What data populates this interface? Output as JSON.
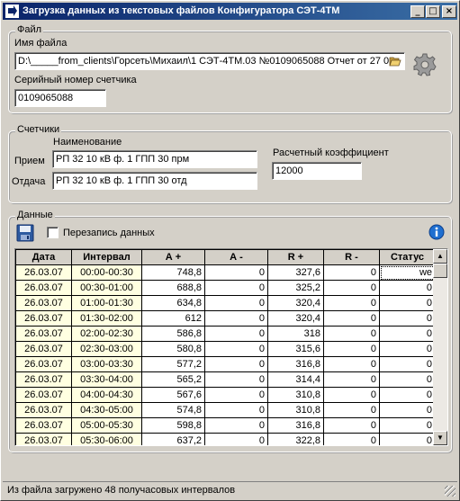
{
  "window": {
    "title": "Загрузка данных из текстовых файлов Конфигуратора СЭТ-4ТМ",
    "minimize": "_",
    "maximize": "□",
    "close": "×"
  },
  "file_group": {
    "legend": "Файл",
    "filename_label": "Имя файла",
    "filename_value": "D:\\_____from_clients\\Горсеть\\Михаил\\1 СЭТ-4ТМ.03 №0109065088 Отчет от 27 0",
    "serial_label": "Серийный номер счетчика",
    "serial_value": "0109065088"
  },
  "meters_group": {
    "legend": "Счетчики",
    "name_header": "Наименование",
    "receive_label": "Прием",
    "receive_value": "РП 32 10 кВ ф. 1 ГПП 30 прм",
    "send_label": "Отдача",
    "send_value": "РП 32 10 кВ ф. 1 ГПП 30 отд",
    "coef_label": "Расчетный коэффициент",
    "coef_value": "12000"
  },
  "data_group": {
    "legend": "Данные",
    "overwrite_label": "Перезапись данных",
    "columns": [
      "Дата",
      "Интервал",
      "А +",
      "А -",
      "R +",
      "R -",
      "Статус"
    ],
    "rows": [
      [
        "26.03.07",
        "00:00-00:30",
        "748,8",
        "0",
        "327,6",
        "0",
        "we"
      ],
      [
        "26.03.07",
        "00:30-01:00",
        "688,8",
        "0",
        "325,2",
        "0",
        "0"
      ],
      [
        "26.03.07",
        "01:00-01:30",
        "634,8",
        "0",
        "320,4",
        "0",
        "0"
      ],
      [
        "26.03.07",
        "01:30-02:00",
        "612",
        "0",
        "320,4",
        "0",
        "0"
      ],
      [
        "26.03.07",
        "02:00-02:30",
        "586,8",
        "0",
        "318",
        "0",
        "0"
      ],
      [
        "26.03.07",
        "02:30-03:00",
        "580,8",
        "0",
        "315,6",
        "0",
        "0"
      ],
      [
        "26.03.07",
        "03:00-03:30",
        "577,2",
        "0",
        "316,8",
        "0",
        "0"
      ],
      [
        "26.03.07",
        "03:30-04:00",
        "565,2",
        "0",
        "314,4",
        "0",
        "0"
      ],
      [
        "26.03.07",
        "04:00-04:30",
        "567,6",
        "0",
        "310,8",
        "0",
        "0"
      ],
      [
        "26.03.07",
        "04:30-05:00",
        "574,8",
        "0",
        "310,8",
        "0",
        "0"
      ],
      [
        "26.03.07",
        "05:00-05:30",
        "598,8",
        "0",
        "316,8",
        "0",
        "0"
      ],
      [
        "26.03.07",
        "05:30-06:00",
        "637,2",
        "0",
        "322,8",
        "0",
        "0"
      ]
    ]
  },
  "statusbar": {
    "text": "Из файла загружено 48 получасовых интервалов"
  },
  "icons": {
    "title_icon": "arrow-icon",
    "folder": "folder-open-icon",
    "settings": "gear-icon",
    "save": "floppy-disk-icon",
    "info": "info-icon"
  },
  "colors": {
    "title_gradient_start": "#0a246a",
    "title_gradient_end": "#3a6ea5",
    "readonly_cell": "#ffffe1",
    "info_blue": "#1f6fd0"
  }
}
